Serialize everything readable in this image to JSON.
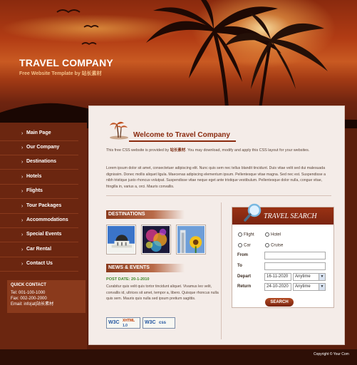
{
  "header": {
    "title": "TRAVEL COMPANY",
    "subtitle": "Free Website Template by 站长素材"
  },
  "nav": {
    "items": [
      {
        "label": "Main Page"
      },
      {
        "label": "Our Company"
      },
      {
        "label": "Destinations"
      },
      {
        "label": "Hotels"
      },
      {
        "label": "Flights"
      },
      {
        "label": "Tour Packages"
      },
      {
        "label": "Accommodations"
      },
      {
        "label": "Special Events"
      },
      {
        "label": "Car Rental"
      },
      {
        "label": "Contact Us"
      }
    ]
  },
  "quick_contact": {
    "title": "QUICK CONTACT",
    "tel": "Tel: 001-100-1000",
    "fax": "Fax: 002-200-2000",
    "email": "Email: info|at|站长素材"
  },
  "welcome": {
    "title": "Welcome to Travel Company",
    "p1_pre": "This free CSS website is provided by ",
    "p1_brand": "站长素材",
    "p1_post": ". You may download, modify and apply this CSS layout for your websites.",
    "p2": "Lorem ipsum dolor sit amet, consectetuer adipiscing elit. Nunc quis sem nec tellus blandit tincidunt. Duis vitae velit sed dui malesuada dignissim. Donec mollis aliquet ligula. Maecenas adipiscing elementum ipsum. Pellentesque vitae magna. Sed nec est. Suspendisse a nibh tristique justo rhoncus volutpat. Suspendisse vitae neque eget ante tristique vestibulum. Pellentesque dolor nulla, congue vitae, fringilla in, varius a, orci. Mauris convallis."
  },
  "destinations": {
    "title": "DESTINATIONS"
  },
  "news": {
    "title": "NEWS & EVENTS",
    "post_date": "POST DATE: 20-1-2010",
    "text": "Curabitur quis velit quis tortor tincidunt aliquet. Vivamus leo velit, convallis id, ultrices sit amet, tempor a, libero. Quisque rhoncus nulla quis sem. Mauris quis nulla sed ipsum pretium sagittis."
  },
  "badges": {
    "xhtml": {
      "w3c": "W3C",
      "kind": "XHTML",
      "version": "1.0"
    },
    "css": {
      "w3c": "W3C",
      "kind": "css"
    }
  },
  "search": {
    "title": "TRAVEL SEARCH",
    "options": [
      "Flight",
      "Hotel",
      "Car",
      "Cruise"
    ],
    "from_label": "From",
    "to_label": "To",
    "depart_label": "Depart",
    "return_label": "Return",
    "depart_date": "16-11-2020",
    "return_date": "24-10-2020",
    "depart_time": "Anytime",
    "return_time": "Anytime",
    "button": "SEARCH"
  },
  "footer": {
    "copyright": "Copyright © Your Com"
  },
  "colors": {
    "accent": "#8a2a0e",
    "sidebar": "#6b2610",
    "content_bg": "#f4ece8",
    "news_date": "#3f8a2a"
  }
}
